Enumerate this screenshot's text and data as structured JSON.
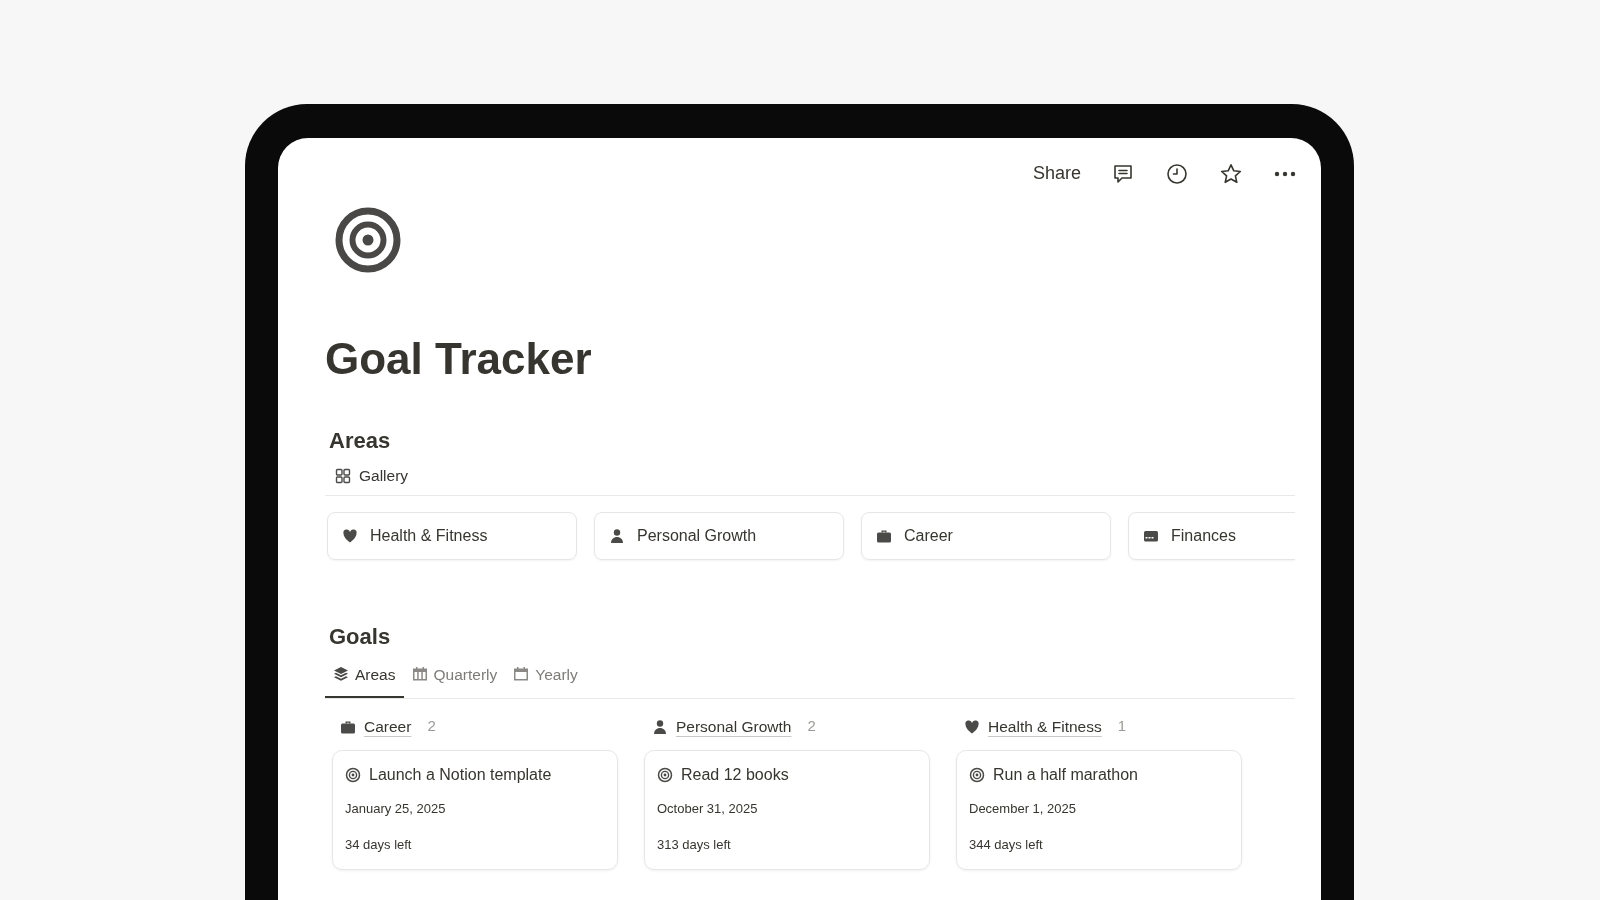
{
  "toolbar": {
    "share": "Share"
  },
  "page": {
    "title": "Goal Tracker"
  },
  "areas": {
    "heading": "Areas",
    "view": "Gallery",
    "cards": [
      {
        "kind": "heart",
        "name": "Health & Fitness"
      },
      {
        "kind": "person",
        "name": "Personal Growth"
      },
      {
        "kind": "briefcase",
        "name": "Career"
      },
      {
        "kind": "card",
        "name": "Finances"
      }
    ]
  },
  "goals": {
    "heading": "Goals",
    "tabs": [
      {
        "kind": "layers",
        "label": "Areas",
        "selected": true
      },
      {
        "kind": "columns",
        "label": "Quarterly",
        "selected": false
      },
      {
        "kind": "calendar",
        "label": "Yearly",
        "selected": false
      }
    ],
    "groups": [
      {
        "kind": "briefcase",
        "name": "Career",
        "count": "2",
        "cards": [
          {
            "title": "Launch a Notion template",
            "date": "January 25, 2025",
            "left": "34 days left"
          }
        ]
      },
      {
        "kind": "person",
        "name": "Personal Growth",
        "count": "2",
        "cards": [
          {
            "title": "Read 12 books",
            "date": "October 31, 2025",
            "left": "313 days left"
          }
        ]
      },
      {
        "kind": "heart",
        "name": "Health & Fitness",
        "count": "1",
        "cards": [
          {
            "title": "Run a half marathon",
            "date": "December 1, 2025",
            "left": "344 days left"
          }
        ]
      }
    ]
  }
}
